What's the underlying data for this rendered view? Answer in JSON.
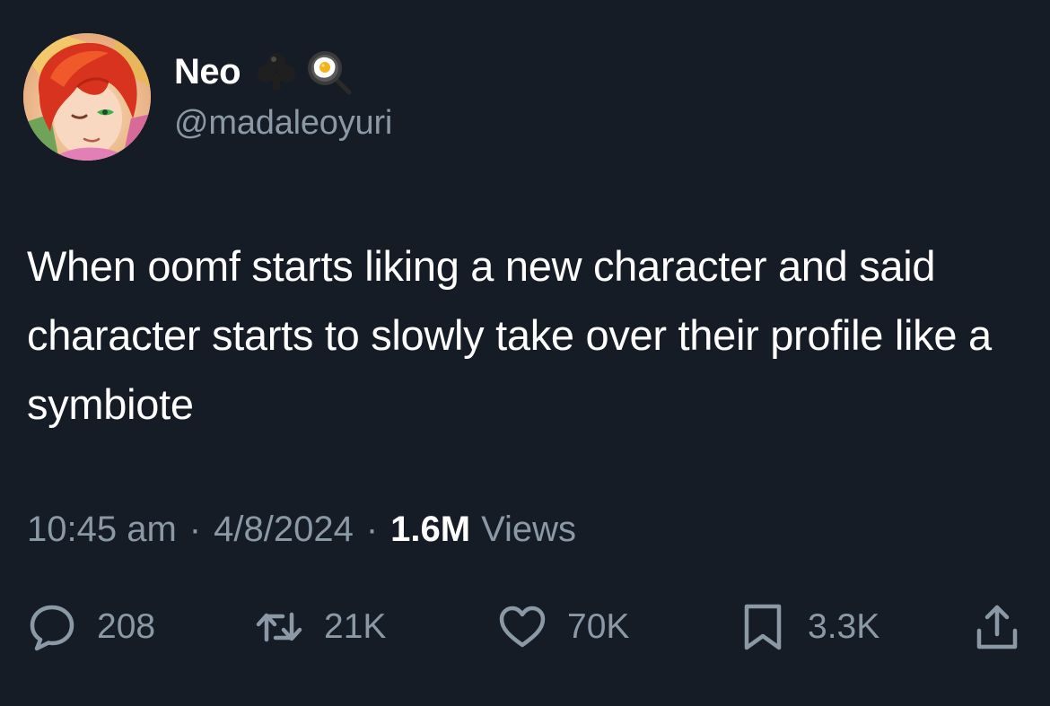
{
  "user": {
    "display_name": "Neo",
    "handle": "@madaleoyuri",
    "name_emojis": [
      "club-suit-emoji",
      "frying-pan-egg-emoji"
    ]
  },
  "tweet": {
    "text": "When oomf starts liking a new character and said character starts to slowly take over their profile like a symbiote",
    "time": "10:45 am",
    "date": "4/8/2024",
    "separator": "·",
    "views_count": "1.6M",
    "views_label": "Views"
  },
  "actions": {
    "replies": "208",
    "retweets": "21K",
    "likes": "70K",
    "bookmarks": "3.3K"
  },
  "icons": {
    "reply": "speech-bubble-icon",
    "retweet": "retweet-arrows-icon",
    "like": "heart-icon",
    "bookmark": "bookmark-icon",
    "share": "share-upload-icon"
  },
  "colors": {
    "background": "#151c26",
    "primary_text": "#ffffff",
    "secondary_text": "#8b98a5"
  }
}
